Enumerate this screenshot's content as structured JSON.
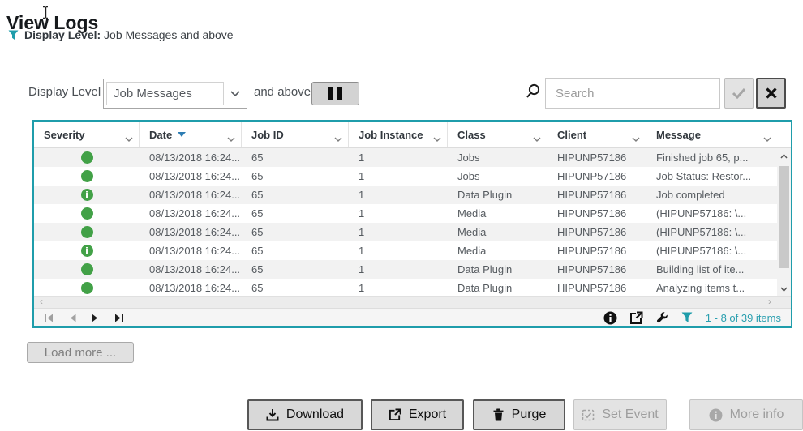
{
  "title": "View Logs",
  "filter_summary": {
    "label": "Display Level:",
    "value": "Job Messages and above"
  },
  "controls": {
    "display_level_label": "Display Level",
    "display_level_value": "Job Messages",
    "and_above_label": "and above",
    "search_placeholder": "Search"
  },
  "table": {
    "columns": [
      "Severity",
      "Date",
      "Job ID",
      "Job Instance",
      "Class",
      "Client",
      "Message"
    ],
    "sorted_column": "Date",
    "sort_direction": "descending",
    "rows": [
      {
        "severity": "success",
        "date": "08/13/2018 16:24...",
        "job_id": "65",
        "job_instance": "1",
        "class": "Jobs",
        "client": "HIPUNP57186",
        "message": "Finished job 65, p..."
      },
      {
        "severity": "success",
        "date": "08/13/2018 16:24...",
        "job_id": "65",
        "job_instance": "1",
        "class": "Jobs",
        "client": "HIPUNP57186",
        "message": "Job Status: Restor..."
      },
      {
        "severity": "info",
        "date": "08/13/2018 16:24...",
        "job_id": "65",
        "job_instance": "1",
        "class": "Data Plugin",
        "client": "HIPUNP57186",
        "message": "Job completed"
      },
      {
        "severity": "success",
        "date": "08/13/2018 16:24...",
        "job_id": "65",
        "job_instance": "1",
        "class": "Media",
        "client": "HIPUNP57186",
        "message": "(HIPUNP57186: \\..."
      },
      {
        "severity": "success",
        "date": "08/13/2018 16:24...",
        "job_id": "65",
        "job_instance": "1",
        "class": "Media",
        "client": "HIPUNP57186",
        "message": "(HIPUNP57186: \\..."
      },
      {
        "severity": "info",
        "date": "08/13/2018 16:24...",
        "job_id": "65",
        "job_instance": "1",
        "class": "Media",
        "client": "HIPUNP57186",
        "message": "(HIPUNP57186: \\..."
      },
      {
        "severity": "success",
        "date": "08/13/2018 16:24...",
        "job_id": "65",
        "job_instance": "1",
        "class": "Data Plugin",
        "client": "HIPUNP57186",
        "message": "Building list of ite..."
      },
      {
        "severity": "success",
        "date": "08/13/2018 16:24...",
        "job_id": "65",
        "job_instance": "1",
        "class": "Data Plugin",
        "client": "HIPUNP57186",
        "message": "Analyzing items t..."
      }
    ],
    "pager_items_text": "1 - 8 of 39 items"
  },
  "load_more_label": "Load more ...",
  "actions": {
    "download": {
      "label": "Download",
      "enabled": true
    },
    "export": {
      "label": "Export",
      "enabled": true
    },
    "purge": {
      "label": "Purge",
      "enabled": true
    },
    "set_event": {
      "label": "Set Event",
      "enabled": false
    },
    "more_info": {
      "label": "More info",
      "enabled": false
    }
  },
  "colors": {
    "accent_teal": "#1f9dab",
    "success_green": "#42a147",
    "sort_arrow_blue": "#2d7db3",
    "items_count_teal": "#2a9faf"
  }
}
